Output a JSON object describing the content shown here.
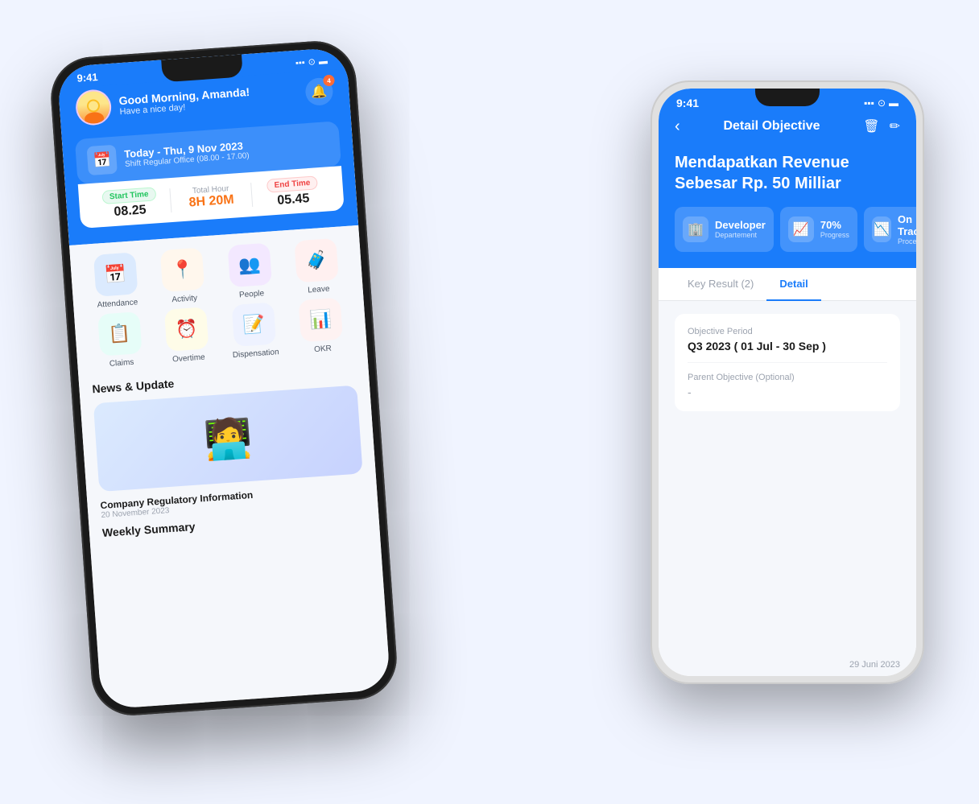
{
  "phone1": {
    "status_time": "9:41",
    "greeting": "Good Morning, Amanda!",
    "greeting_sub": "Have a nice day!",
    "notif_count": "4",
    "attendance_title": "Today - Thu, 9 Nov 2023",
    "attendance_sub": "Shift Regular Office (08.00 - 17.00)",
    "start_time_label": "Start Time",
    "start_time_value": "08.25",
    "total_hour_label": "Total Hour",
    "total_hour_value": "8H 20M",
    "end_time_label": "End Time",
    "end_time_value": "05.45",
    "icons": [
      {
        "label": "Attendance",
        "emoji": "📅",
        "bg": "ib-blue"
      },
      {
        "label": "Activity",
        "emoji": "📍",
        "bg": "ib-orange"
      },
      {
        "label": "People",
        "emoji": "👥",
        "bg": "ib-purple"
      },
      {
        "label": "Leave",
        "emoji": "🧳",
        "bg": "ib-red"
      },
      {
        "label": "Claims",
        "emoji": "📋",
        "bg": "ib-teal"
      },
      {
        "label": "Overtime",
        "emoji": "⏰",
        "bg": "ib-yellow"
      },
      {
        "label": "Dispensation",
        "emoji": "📝",
        "bg": "ib-indigo"
      },
      {
        "label": "OKR",
        "emoji": "📊",
        "bg": "ib-chart"
      }
    ],
    "news_section_title": "News & Update",
    "news_item_title": "Company Regulatory Information",
    "news_item_date": "20 November 2023",
    "weekly_summary_title": "Weekly Summary"
  },
  "phone2": {
    "status_time": "9:41",
    "screen_title": "Detail Objective",
    "objective_title": "Mendapatkan Revenue Sebesar Rp. 50 Milliar",
    "stat1_label": "Developer",
    "stat1_sub": "Departement",
    "stat1_icon": "🏢",
    "stat2_label": "70%",
    "stat2_sub": "Progress",
    "stat2_icon": "📈",
    "stat3_label": "On Track",
    "stat3_sub": "Process",
    "stat3_icon": "📉",
    "tab1": "Key Result (2)",
    "tab2": "Detail",
    "field1_label": "Objective Period",
    "field1_value": "Q3 2023 ( 01 Jul - 30 Sep )",
    "field2_label": "Parent Objective (Optional)",
    "field2_value": "-",
    "footer_date": "29 Juni 2023"
  }
}
